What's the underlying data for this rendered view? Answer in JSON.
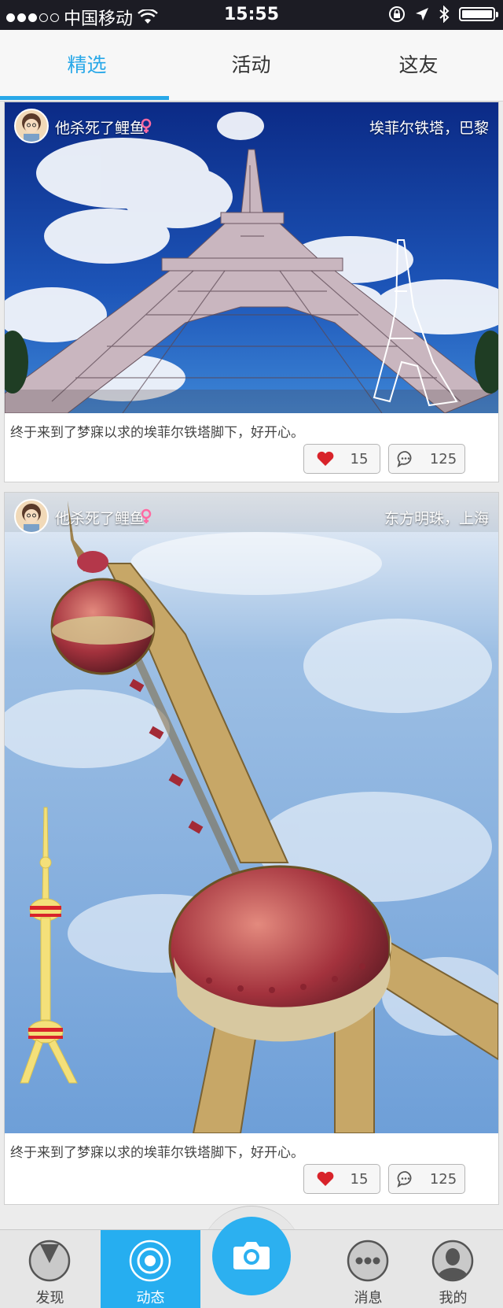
{
  "status_bar": {
    "carrier": "中国移动",
    "time": "15:55"
  },
  "tabs": [
    {
      "label": "精选",
      "active": true
    },
    {
      "label": "活动",
      "active": false
    },
    {
      "label": "这友",
      "active": false
    }
  ],
  "posts": [
    {
      "username": "他杀死了鲤鱼",
      "location": "埃菲尔铁塔，巴黎",
      "caption": "终于来到了梦寐以求的埃菲尔铁塔脚下，好开心。",
      "likes": "15",
      "comments": "125"
    },
    {
      "username": "他杀死了鲤鱼",
      "location": "东方明珠，上海",
      "caption": "终于来到了梦寐以求的埃菲尔铁塔脚下，好开心。",
      "likes": "15",
      "comments": "125"
    }
  ],
  "tab_bar": [
    {
      "label": "发现",
      "icon": "compass-icon",
      "active": false
    },
    {
      "label": "动态",
      "icon": "target-icon",
      "active": true
    },
    {
      "label": "",
      "icon": "camera-icon",
      "active": false
    },
    {
      "label": "消息",
      "icon": "message-dots-icon",
      "active": false
    },
    {
      "label": "我的",
      "icon": "profile-icon",
      "active": false
    }
  ],
  "colors": {
    "accent": "#29a8e8",
    "like": "#d8232a"
  }
}
